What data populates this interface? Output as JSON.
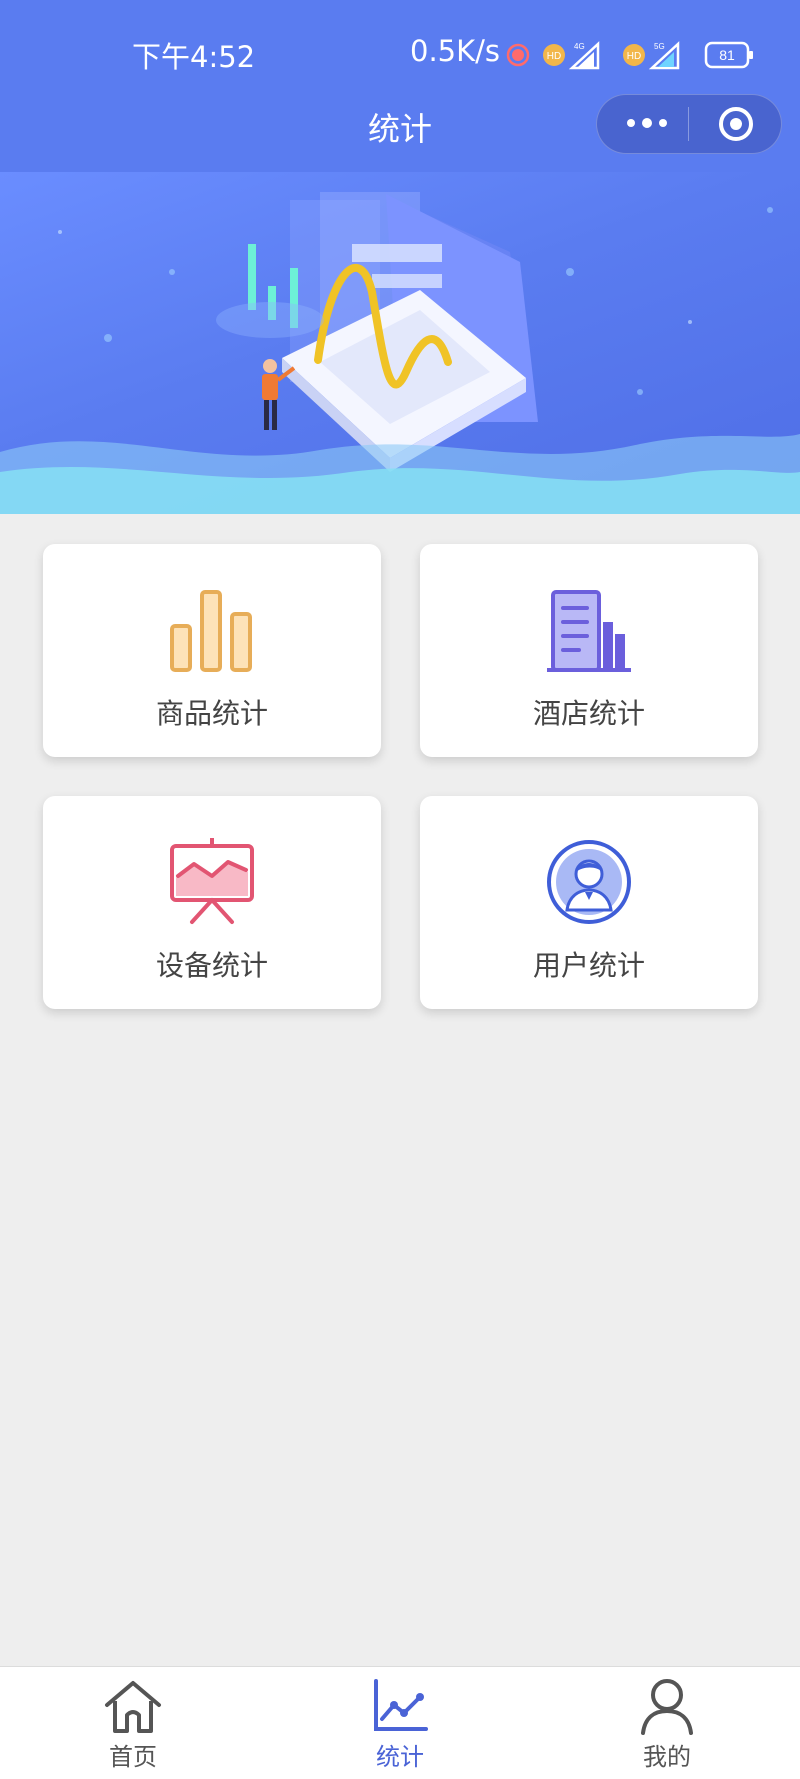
{
  "status_bar": {
    "time": "下午4:52",
    "network_speed": "0.5K/s",
    "icons": [
      "alarm-icon",
      "hd-icon",
      "signal-4g-icon",
      "hd-icon",
      "signal-5g-icon",
      "battery-icon"
    ],
    "hd_label": "HD",
    "sig1_label": "4G",
    "sig2_label": "5G",
    "battery": "81"
  },
  "header": {
    "title": "统计",
    "capsule": {
      "more_icon": "more-dots-icon",
      "close_icon": "target-icon"
    }
  },
  "theme": {
    "primary": "#5a7cf0",
    "tab_active": "#4a63d6",
    "goods_color": "#e7ad58",
    "hotel_color": "#6b5fdc",
    "device_color": "#e25572",
    "user_color": "#3f5ed8"
  },
  "cards": [
    {
      "label": "商品统计",
      "icon": "bar-chart-icon"
    },
    {
      "label": "酒店统计",
      "icon": "building-icon"
    },
    {
      "label": "设备统计",
      "icon": "presentation-board-icon"
    },
    {
      "label": "用户统计",
      "icon": "user-avatar-icon"
    }
  ],
  "tabbar": {
    "items": [
      {
        "label": "首页",
        "icon": "home-icon",
        "active": false
      },
      {
        "label": "统计",
        "icon": "line-chart-icon",
        "active": true
      },
      {
        "label": "我的",
        "icon": "person-icon",
        "active": false
      }
    ]
  }
}
